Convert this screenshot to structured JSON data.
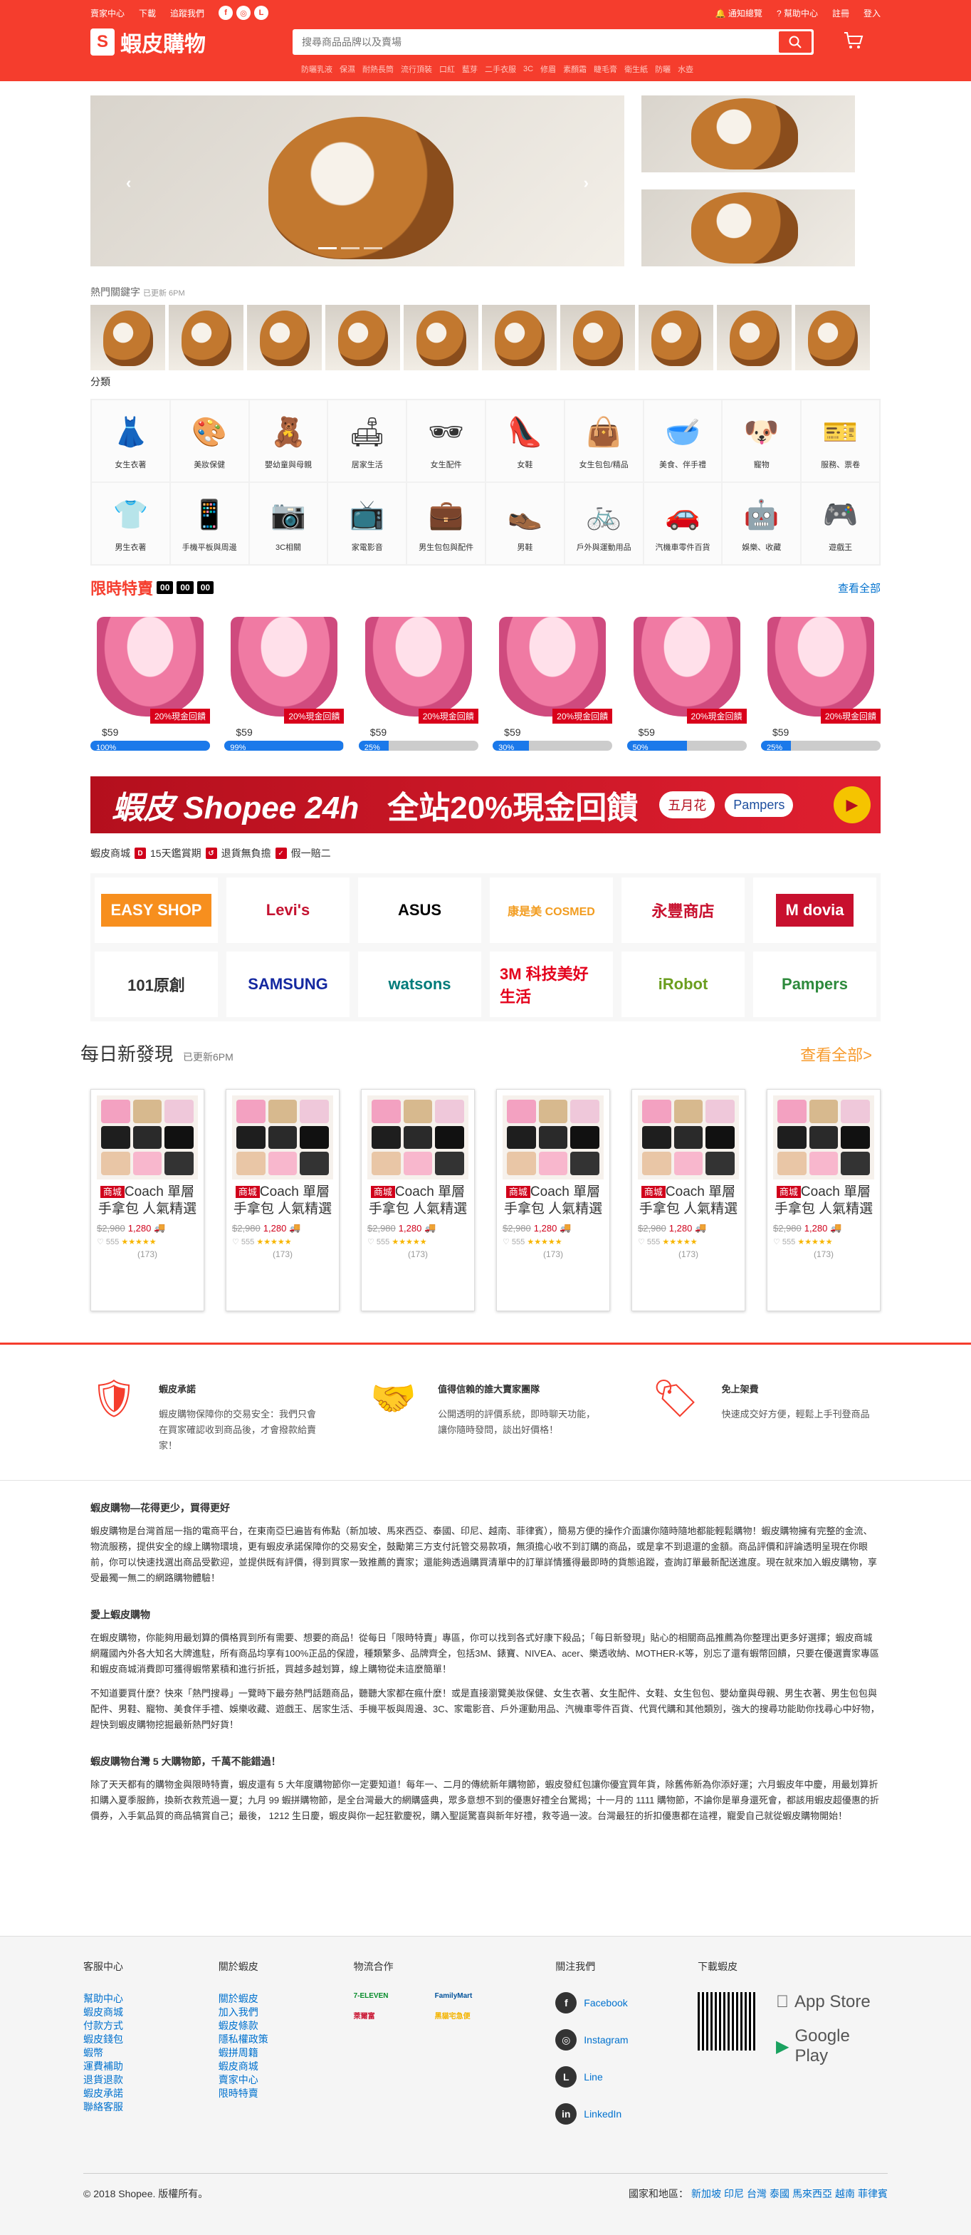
{
  "header": {
    "links_left": [
      "賣家中心",
      "下載",
      "追蹤我們"
    ],
    "links_right": [
      "通知總覽",
      "幫助中心",
      "註冊",
      "登入"
    ],
    "logo_text": "蝦皮購物",
    "search_placeholder": "搜尋商品品牌以及賣場",
    "hot_keywords": [
      "防曬乳液",
      "保濕",
      "耐熱長筒",
      "流行頂裝",
      "口紅",
      "藍芽",
      "二手衣服",
      "3C",
      "修眉",
      "素顏霜",
      "睫毛膏",
      "衛生紙",
      "防曬",
      "水壺"
    ]
  },
  "banner": {
    "prev": "‹",
    "next": "›"
  },
  "keywords": {
    "title": "熱門關鍵字",
    "updated": "已更新 6PM"
  },
  "categories": {
    "title": "分類",
    "items": [
      {
        "label": "女生衣著",
        "icon": "dress-icon"
      },
      {
        "label": "美妝保健",
        "icon": "makeup-palette-icon"
      },
      {
        "label": "嬰幼童與母親",
        "icon": "baby-icon"
      },
      {
        "label": "居家生活",
        "icon": "sofa-icon"
      },
      {
        "label": "女生配件",
        "icon": "sunglasses-icon"
      },
      {
        "label": "女鞋",
        "icon": "heels-icon"
      },
      {
        "label": "女生包包/精品",
        "icon": "handbag-icon"
      },
      {
        "label": "美食、伴手禮",
        "icon": "food-bowl-icon"
      },
      {
        "label": "寵物",
        "icon": "dog-icon"
      },
      {
        "label": "服務、票卷",
        "icon": "ticket-icon"
      },
      {
        "label": "男生衣著",
        "icon": "polo-shirt-icon"
      },
      {
        "label": "手機平板與周邊",
        "icon": "smartphone-icon"
      },
      {
        "label": "3C相關",
        "icon": "camera-icon"
      },
      {
        "label": "家電影音",
        "icon": "tv-icon"
      },
      {
        "label": "男生包包與配件",
        "icon": "messenger-bag-icon"
      },
      {
        "label": "男鞋",
        "icon": "mens-shoe-icon"
      },
      {
        "label": "戶外與運動用品",
        "icon": "bicycle-icon"
      },
      {
        "label": "汽機車零件百貨",
        "icon": "car-icon"
      },
      {
        "label": "娛樂、收藏",
        "icon": "figure-icon"
      },
      {
        "label": "遊戲王",
        "icon": "gamepad-icon"
      }
    ]
  },
  "flash_sale": {
    "title": "限時特賣",
    "timer": [
      "00",
      "00",
      "00"
    ],
    "see_all": "查看全部",
    "tag": "20%現金回饋",
    "items": [
      {
        "price": "$59",
        "progress": "100%",
        "p": 100
      },
      {
        "price": "$59",
        "progress": "99%",
        "p": 99
      },
      {
        "price": "$59",
        "progress": "25%",
        "p": 25
      },
      {
        "price": "$59",
        "progress": "30%",
        "p": 30
      },
      {
        "price": "$59",
        "progress": "50%",
        "p": 50
      },
      {
        "price": "$59",
        "progress": "25%",
        "p": 25
      }
    ]
  },
  "promo": {
    "brand": "蝦皮 Shopee",
    "brand_24h": "24h",
    "text": "全站20%現金回饋",
    "partner1": "五月花",
    "partner2": "Pampers"
  },
  "mall": {
    "title": "蝦皮商城",
    "perks": [
      "15天鑑賞期",
      "退貨無負擔",
      "假一賠二"
    ],
    "brands": [
      "EASY SHOP",
      "Levi's",
      "ASUS",
      "康是美 COSMED",
      "永豐商店",
      "M dovia",
      "101原創",
      "SAMSUNG",
      "watsons",
      "3M 科技美好生活",
      "iRobot",
      "Pampers"
    ]
  },
  "daily": {
    "title": "每日新發現",
    "updated": "已更新6PM",
    "see_all": "查看全部>",
    "mall_tag": "商城",
    "name": "Coach 單層手拿包 人氣精選",
    "old": "$2,980",
    "new": "1,280",
    "likes": "555",
    "stars": "★★★★★",
    "sold": "(173)",
    "count": 6
  },
  "features": [
    {
      "title": "蝦皮承諾",
      "text": "蝦皮購物保障你的交易安全：我們只會在買家確認收到商品後，才會撥款給賣家！",
      "icon": "shield-s-icon"
    },
    {
      "title": "值得信賴的誰大賣家團隊",
      "text": "公開透明的評價系統，即時聊天功能，讓你隨時發問，談出好價格！",
      "icon": "handshake-icon"
    },
    {
      "title": "免上架費",
      "text": "快速成交好方便，輕鬆上手刊登商品",
      "icon": "free-tag-icon"
    }
  ],
  "about": {
    "h1": "蝦皮購物—花得更少，買得更好",
    "p1": "蝦皮購物是台灣首屈一指的電商平台，在東南亞巳遍皆有佈點（新加坡、馬來西亞、泰國、印尼、越南、菲律賓），簡易方便的操作介面讓你隨時隨地都能輕鬆購物！蝦皮購物擁有完整的金流、物流服務，提供安全的線上購物環境，更有蝦皮承諾保障你的交易安全，鼓勵第三方支付託管交易款項，無須擔心收不到訂購的商品，或是拿不到退還的金額。商品評價和評論透明呈現在你眼前，你可以快速找選出商品受歡迎，並提供既有評價，得到買家一致推薦的賣家；還能夠透過購買清單中的訂單詳情獲得最即時的貨態追蹤，查詢訂單最新配送進度。現在就來加入蝦皮購物，享受最獨一無二的網路購物體驗！",
    "h2": "愛上蝦皮購物",
    "p2": "在蝦皮購物，你能夠用最划算的價格買到所有需要、想要的商品！從每日「限時特賣」專區，你可以找到各式好康下殺品；「每日新發現」貼心的相關商品推薦為你整理出更多好選擇；蝦皮商城網羅國內外各大知名大牌進駐，所有商品均享有100%正品的保證，種類繁多、品牌齊全，包括3M、錶寶、NIVEA、acer、樂透收納、MOTHER-K等，別忘了還有蝦幣回饋，只要在優選賣家專區和蝦皮商城消費即可獲得蝦幣累積和進行折抵，買越多越划算，線上購物從未這麼簡單！",
    "p3": "不知道要買什麼？快來「熱門搜尋」一覽時下最夯熱門話題商品，聽聽大家都在瘋什麼！或是直接瀏覽美妝保健、女生衣著、女生配件、女鞋、女生包包、嬰幼童與母親、男生衣著、男生包包與配件、男鞋、寵物、美食伴手禮、娛樂收藏、遊戲王、居家生活、手機平板與周邊、3C、家電影音、戶外運動用品、汽機車零件百貨、代買代購和其他類別，強大的搜尋功能助你找尋心中好物，趕快到蝦皮購物挖掘最新熱門好貨！",
    "h3": "蝦皮購物台灣 5 大購物節，千萬不能錯過！",
    "p4": "除了天天都有的購物金與限時特賣，蝦皮還有 5 大年度購物節你一定要知道！每年一、二月的傳統新年購物節，蝦皮發紅包讓你優宜買年貨，除舊佈新為你添好運；六月蝦皮年中慶，用最划算折扣購入夏季服飾，換新衣救荒過一夏；九月 99 蝦拼購物節，是全台灣最大的網購盛典，眾多意想不到的優惠好禮全台驚揭；十一月的 1111 購物節，不論你是單身還死會，都該用蝦皮超優惠的折價券，入手氣品質的商品犒賞自己；最後， 1212 生日慶，蝦皮與你一起狂歡慶祝，購入聖誕驚喜與新年好禮，救苓過一波。台灣最狂的折扣優惠都在這裡，寵愛自己就從蝦皮購物開始！"
  },
  "footer": {
    "cs_title": "客服中心",
    "cs": [
      "幫助中心",
      "蝦皮商城",
      "付款方式",
      "蝦皮錢包",
      "蝦幣",
      "運費補助",
      "退貨退款",
      "蝦皮承諾",
      "聯絡客服"
    ],
    "about_title": "關於蝦皮",
    "about": [
      "關於蝦皮",
      "加入我們",
      "蝦皮條款",
      "隱私權政策",
      "蝦拼周籍",
      "蝦皮商城",
      "賣家中心",
      "限時特賣"
    ],
    "logistics_title": "物流合作",
    "logistics": [
      "7-ELEVEN",
      "FamilyMart",
      "萊爾富",
      "黑貓宅急便"
    ],
    "follow_title": "關注我們",
    "follow": [
      {
        "name": "Facebook",
        "icon": "facebook-icon",
        "g": "f"
      },
      {
        "name": "Instagram",
        "icon": "instagram-icon",
        "g": "◎"
      },
      {
        "name": "Line",
        "icon": "line-icon",
        "g": "L"
      },
      {
        "name": "LinkedIn",
        "icon": "linkedin-icon",
        "g": "in"
      }
    ],
    "download_title": "下載蝦皮",
    "app_store": "App Store",
    "google_play": "Google Play",
    "copyright": "© 2018 Shopee. 版權所有。",
    "regions_label": "國家和地區：",
    "regions": [
      "新加坡",
      "印尼",
      "台灣",
      "泰國",
      "馬來西亞",
      "越南",
      "菲律賓"
    ]
  }
}
